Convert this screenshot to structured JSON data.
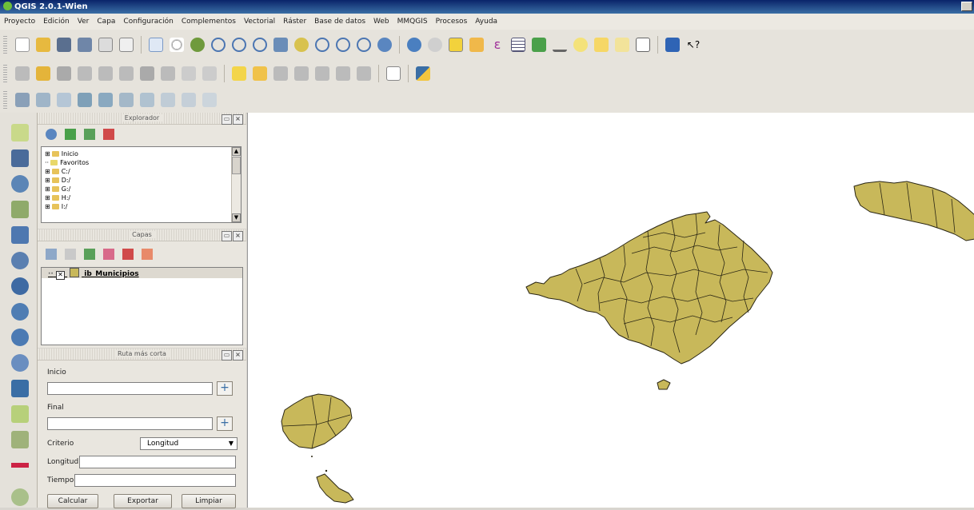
{
  "window": {
    "title": "QGIS 2.0.1-Wien"
  },
  "menu": [
    "Proyecto",
    "Edición",
    "Ver",
    "Capa",
    "Configuración",
    "Complementos",
    "Vectorial",
    "Ráster",
    "Base de datos",
    "Web",
    "MMQGIS",
    "Procesos",
    "Ayuda"
  ],
  "explorer": {
    "title": "Explorador",
    "items": [
      {
        "expander": "⊞",
        "label": "Inicio",
        "icon": "folder-icon"
      },
      {
        "expander": "··",
        "label": "Favoritos",
        "icon": "star-icon"
      },
      {
        "expander": "⊞",
        "label": "C:/",
        "icon": "folder-icon"
      },
      {
        "expander": "⊞",
        "label": "D:/",
        "icon": "folder-icon"
      },
      {
        "expander": "⊞",
        "label": "G:/",
        "icon": "folder-icon"
      },
      {
        "expander": "⊞",
        "label": "H:/",
        "icon": "folder-icon"
      },
      {
        "expander": "⊞",
        "label": "I:/",
        "icon": "folder-icon"
      }
    ]
  },
  "layers": {
    "title": "Capas",
    "items": [
      {
        "label": "ib_Municipios",
        "checked": true,
        "color": "#c8b85a"
      }
    ]
  },
  "route": {
    "title": "Ruta más corta",
    "start_label": "Inicio",
    "start_value": "",
    "end_label": "Final",
    "end_value": "",
    "criterion_label": "Criterio",
    "criterion_value": "Longitud",
    "length_label": "Longitud",
    "length_value": "",
    "time_label": "Tiempo",
    "time_value": "",
    "calculate": "Calcular",
    "export": "Exportar",
    "clear": "Limpiar"
  },
  "map": {
    "fill": "#c8b85a",
    "stroke": "#2a2614",
    "background": "#ffffff"
  }
}
